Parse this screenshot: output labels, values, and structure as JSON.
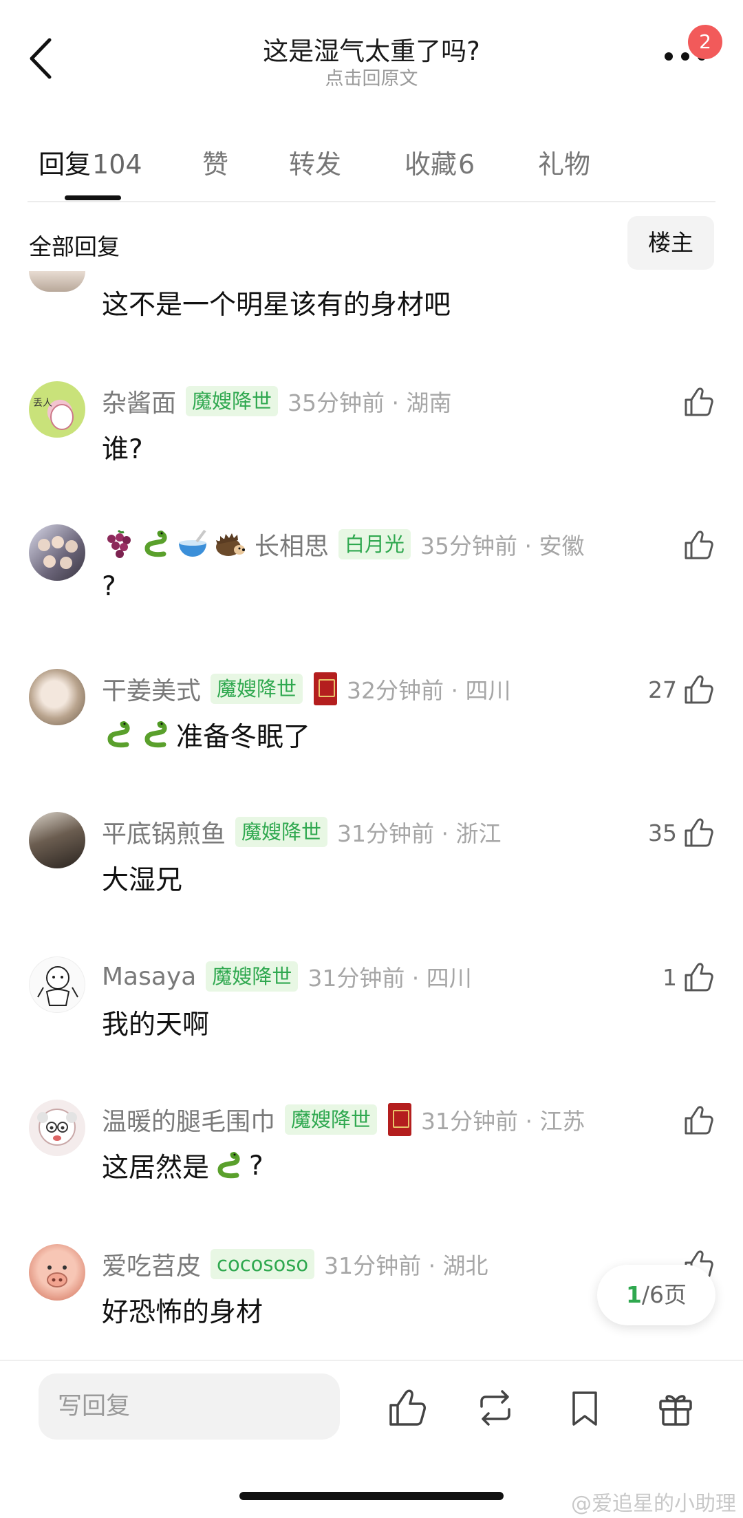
{
  "header": {
    "title": "这是湿气太重了吗?",
    "subtitle": "点击回原文",
    "notification_count": "2"
  },
  "tabs": [
    {
      "label": "回复",
      "count": "104",
      "active": true
    },
    {
      "label": "赞",
      "count": ""
    },
    {
      "label": "转发",
      "count": ""
    },
    {
      "label": "收藏",
      "count": "6"
    },
    {
      "label": "礼物",
      "count": ""
    }
  ],
  "filter": {
    "all_replies": "全部回复",
    "owner_only": "楼主"
  },
  "first_comment_text": "这不是一个明星该有的身材吧",
  "comments": [
    {
      "username": "杂酱面",
      "badge": "魔嫂降世",
      "time": "35分钟前 · 湖南",
      "text": "谁?",
      "likes": ""
    },
    {
      "username": "长相思",
      "name_emojis": [
        "grape-icon",
        "snake-icon",
        "bowl-icon",
        "hedgehog-icon"
      ],
      "badge": "白月光",
      "time": "35分钟前 · 安徽",
      "text": "?",
      "likes": ""
    },
    {
      "username": "干姜美式",
      "badge": "魔嫂降世",
      "time": "32分钟前 · 四川",
      "text": "准备冬眠了",
      "text_emojis": [
        "snake-icon",
        "snake-icon"
      ],
      "likes": "27"
    },
    {
      "username": "平底锅煎鱼",
      "badge": "魔嫂降世",
      "time": "31分钟前 · 浙江",
      "text": "大湿兄",
      "likes": "35"
    },
    {
      "username": "Masaya",
      "badge": "魔嫂降世",
      "time": "31分钟前 · 四川",
      "text": "我的天啊",
      "likes": "1"
    },
    {
      "username": "温暖的腿毛围巾",
      "badge": "魔嫂降世",
      "time": "31分钟前 · 江苏",
      "text_before": "这居然是",
      "text_after": "?",
      "likes": ""
    },
    {
      "username": "爱吃苕皮",
      "badge": "cocososo",
      "time": "31分钟前 · 湖北",
      "text": "好恐怖的身材",
      "likes": ""
    }
  ],
  "pager": {
    "current": "1",
    "total_label": "/6页"
  },
  "bottom_bar": {
    "reply_placeholder": "写回复"
  },
  "watermark": "@爱追星的小助理",
  "colors": {
    "accent_green": "#2fa84f",
    "badge_bg": "#e8f7e4",
    "notif_red": "#f25a5a"
  }
}
